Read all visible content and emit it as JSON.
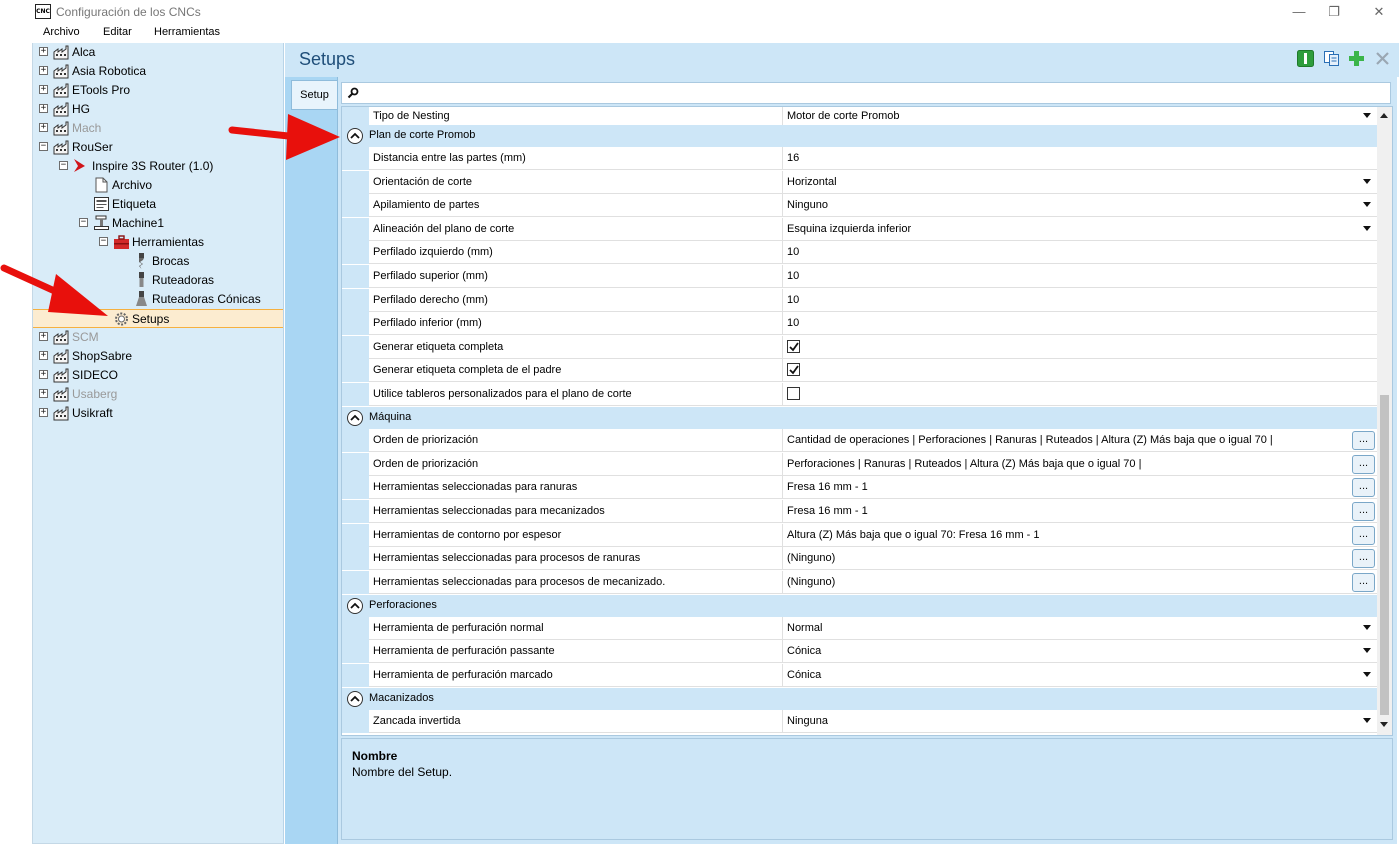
{
  "window": {
    "title": "Configuración de los CNCs",
    "app_icon_text": "CNC",
    "minimize": "—",
    "restore": "❐",
    "close": "✕"
  },
  "menu": [
    "Archivo",
    "Editar",
    "Herramientas"
  ],
  "tree": [
    {
      "label": "Alca",
      "icon": "factory-icon",
      "gray": false
    },
    {
      "label": "Asia Robotica",
      "icon": "factory-icon",
      "gray": false
    },
    {
      "label": "ETools Pro",
      "icon": "factory-icon",
      "gray": false
    },
    {
      "label": "HG",
      "icon": "factory-icon",
      "gray": false
    },
    {
      "label": "Mach",
      "icon": "factory-icon",
      "gray": true
    },
    {
      "label": "RouSer",
      "icon": "factory-icon",
      "gray": false
    },
    {
      "label": "Inspire 3S Router (1.0)",
      "icon": "red-chevron-icon",
      "gray": false
    },
    {
      "label": "Archivo",
      "icon": "document-icon",
      "gray": false
    },
    {
      "label": "Etiqueta",
      "icon": "label-icon",
      "gray": false
    },
    {
      "label": "Machine1",
      "icon": "machine-icon",
      "gray": false
    },
    {
      "label": "Herramientas",
      "icon": "toolbox-icon",
      "gray": false
    },
    {
      "label": "Brocas",
      "icon": "drill-bit-icon",
      "gray": false
    },
    {
      "label": "Ruteadoras",
      "icon": "router-bit-icon",
      "gray": false
    },
    {
      "label": "Ruteadoras Cónicas",
      "icon": "conical-bit-icon",
      "gray": false
    },
    {
      "label": "Setups",
      "icon": "gear-icon",
      "gray": false
    },
    {
      "label": "SCM",
      "icon": "factory-icon",
      "gray": true
    },
    {
      "label": "ShopSabre",
      "icon": "factory-icon",
      "gray": false
    },
    {
      "label": "SIDECO",
      "icon": "factory-icon",
      "gray": false
    },
    {
      "label": "Usaberg",
      "icon": "factory-icon",
      "gray": true
    },
    {
      "label": "Usikraft",
      "icon": "factory-icon",
      "gray": false
    }
  ],
  "main": {
    "title": "Setups",
    "tab": "Setup",
    "toolbar_icons": [
      "rename-icon",
      "copy-icon",
      "add-icon",
      "delete-icon"
    ]
  },
  "grid": {
    "top_row": {
      "name": "Tipo de Nesting",
      "value": "Motor de corte Promob"
    },
    "sections": [
      {
        "title": "Plan de corte Promob",
        "rows": [
          {
            "name": "Distancia entre las partes (mm)",
            "value": "16",
            "kind": "text"
          },
          {
            "name": "Orientación de corte",
            "value": "Horizontal",
            "kind": "dropdown"
          },
          {
            "name": "Apilamiento de partes",
            "value": "Ninguno",
            "kind": "dropdown"
          },
          {
            "name": "Alineación del plano de corte",
            "value": "Esquina izquierda inferior",
            "kind": "dropdown"
          },
          {
            "name": "Perfilado izquierdo (mm)",
            "value": "10",
            "kind": "text"
          },
          {
            "name": "Perfilado superior (mm)",
            "value": "10",
            "kind": "text"
          },
          {
            "name": "Perfilado derecho (mm)",
            "value": "10",
            "kind": "text"
          },
          {
            "name": "Perfilado inferior (mm)",
            "value": "10",
            "kind": "text"
          },
          {
            "name": "Generar etiqueta completa",
            "value": true,
            "kind": "checkbox"
          },
          {
            "name": "Generar etiqueta completa de el padre",
            "value": true,
            "kind": "checkbox"
          },
          {
            "name": "Utilice tableros personalizados para el plano de corte",
            "value": false,
            "kind": "checkbox"
          }
        ]
      },
      {
        "title": "Máquina",
        "rows": [
          {
            "name": "Orden de priorización",
            "value": "Cantidad de operaciones | Perforaciones | Ranuras | Ruteados | Altura (Z) Más baja que o igual 70 |",
            "kind": "ellipsis"
          },
          {
            "name": "Orden de priorización",
            "value": "Perforaciones | Ranuras | Ruteados | Altura (Z) Más baja que o igual 70 |",
            "kind": "ellipsis"
          },
          {
            "name": "Herramientas seleccionadas para ranuras",
            "value": "Fresa 16 mm - 1",
            "kind": "ellipsis"
          },
          {
            "name": "Herramientas seleccionadas para mecanizados",
            "value": "Fresa 16 mm - 1",
            "kind": "ellipsis"
          },
          {
            "name": "Herramientas de contorno por espesor",
            "value": "Altura (Z) Más baja que o igual 70: Fresa 16 mm - 1",
            "kind": "ellipsis"
          },
          {
            "name": "Herramientas seleccionadas para procesos de ranuras",
            "value": "(Ninguno)",
            "kind": "ellipsis"
          },
          {
            "name": "Herramientas seleccionadas para procesos de mecanizado.",
            "value": "(Ninguno)",
            "kind": "ellipsis"
          }
        ]
      },
      {
        "title": "Perforaciones",
        "rows": [
          {
            "name": "Herramienta de perfuración normal",
            "value": "Normal",
            "kind": "dropdown"
          },
          {
            "name": "Herramienta de perfuración passante",
            "value": "Cónica",
            "kind": "dropdown"
          },
          {
            "name": "Herramienta de perfuración marcado",
            "value": "Cónica",
            "kind": "dropdown"
          }
        ]
      },
      {
        "title": "Macanizados",
        "rows": [
          {
            "name": "Zancada invertida",
            "value": "Ninguna",
            "kind": "dropdown"
          }
        ]
      }
    ],
    "ellipsis_label": "..."
  },
  "description": {
    "title": "Nombre",
    "text": "Nombre del Setup."
  },
  "colors": {
    "tree_bg": "#d9ecf8",
    "panel_bg": "#cde6f7",
    "title_blue": "#1f4e79",
    "selected_bg": "#fcecd0",
    "selected_border": "#f5b040",
    "annotation_red": "#e8100c"
  }
}
